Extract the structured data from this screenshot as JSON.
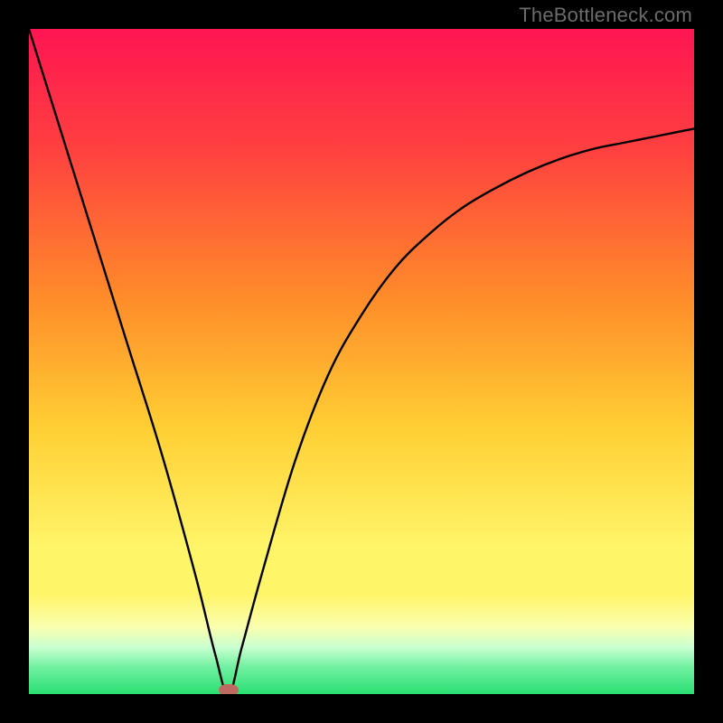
{
  "watermark": "TheBottleneck.com",
  "colors": {
    "top": "#ff1552",
    "mid1": "#ff7a2c",
    "mid2": "#ffd633",
    "yellow_plateau": "#fff569",
    "bottom": "#2adf72",
    "curve": "#000000",
    "marker": "#bf6a60",
    "frame": "#000000"
  },
  "chart_data": {
    "type": "line",
    "title": "",
    "xlabel": "",
    "ylabel": "",
    "xlim": [
      0,
      1
    ],
    "ylim": [
      0,
      100
    ],
    "note": "Curve depicts a bottleneck-mismatch profile: it falls steeply from top-left, hits a minimum near x≈0.30 (y≈0), then rises with diminishing slope toward the upper-right. A small marker sits at the minimum.",
    "series": [
      {
        "name": "bottleneck-curve",
        "x": [
          0.0,
          0.05,
          0.1,
          0.15,
          0.2,
          0.25,
          0.28,
          0.3,
          0.32,
          0.35,
          0.4,
          0.45,
          0.5,
          0.55,
          0.6,
          0.65,
          0.7,
          0.75,
          0.8,
          0.85,
          0.9,
          0.95,
          1.0
        ],
        "y": [
          100,
          84,
          68,
          52,
          36,
          18,
          6,
          0,
          7,
          18,
          35,
          48,
          57,
          64,
          69,
          73,
          76,
          78.5,
          80.5,
          82,
          83,
          84,
          85
        ]
      }
    ],
    "marker": {
      "x": 0.3,
      "y": 0
    }
  }
}
